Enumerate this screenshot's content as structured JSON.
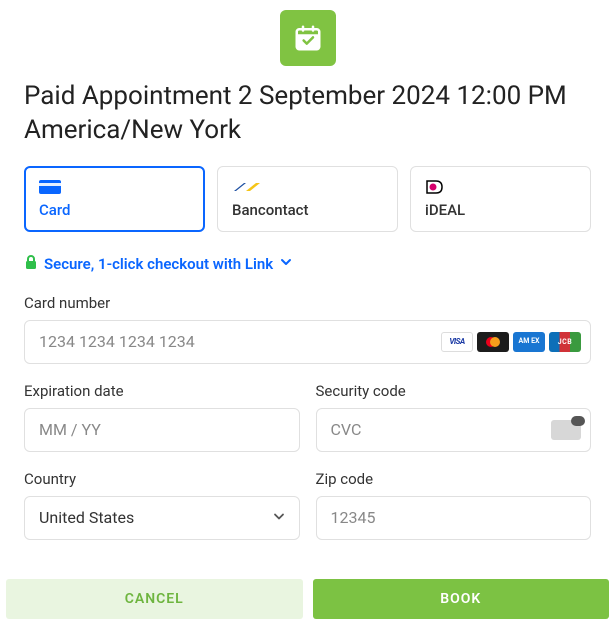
{
  "title": "Paid Appointment 2 September 2024 12:00 PM America/New York",
  "tabs": {
    "card": {
      "label": "Card"
    },
    "bancontact": {
      "label": "Bancontact"
    },
    "ideal": {
      "label": "iDEAL"
    }
  },
  "link_checkout": "Secure, 1-click checkout with Link",
  "fields": {
    "card_number": {
      "label": "Card number",
      "placeholder": "1234 1234 1234 1234"
    },
    "expiration": {
      "label": "Expiration date",
      "placeholder": "MM / YY"
    },
    "security": {
      "label": "Security code",
      "placeholder": "CVC"
    },
    "country": {
      "label": "Country",
      "value": "United States"
    },
    "zip": {
      "label": "Zip code",
      "placeholder": "12345"
    }
  },
  "buttons": {
    "cancel": "CANCEL",
    "book": "BOOK"
  },
  "card_brands": {
    "visa": "VISA",
    "amex": "AM EX",
    "jcb": "JCB"
  }
}
